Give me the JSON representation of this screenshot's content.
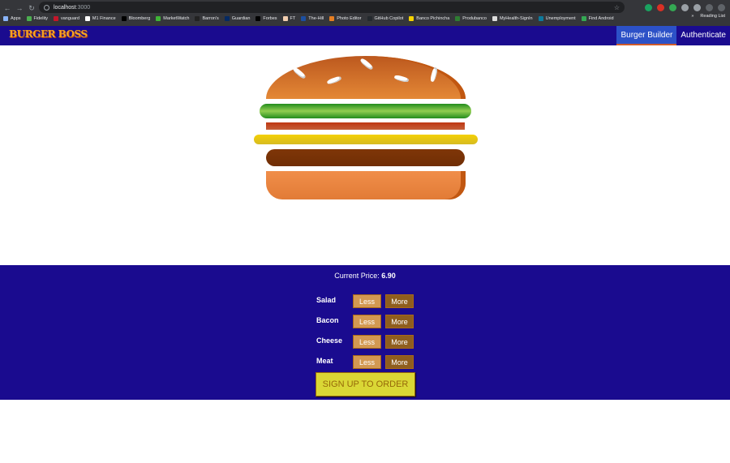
{
  "browser": {
    "url_host": "localhost",
    "url_port": ":3000",
    "bookmarks": [
      "Apps",
      "Fidelity",
      "vanguard",
      "M1 Finance",
      "Bloomberg",
      "MarketWatch",
      "Barron's",
      "Guardian",
      "Forbes",
      "FT",
      "The-Hill",
      "Photo Editor",
      "GitHub Copilot",
      "Banco Pichincha",
      "Produbanco",
      "MyHealth-SignIn",
      "Unemployment",
      "Find Android"
    ],
    "reading_list": "Reading List",
    "more_bookmarks": "»"
  },
  "toolbar": {
    "logo_text": "BURGER BOSS",
    "nav": [
      {
        "label": "Burger Builder",
        "active": true
      },
      {
        "label": "Authenticate",
        "active": false
      }
    ]
  },
  "burger": {
    "ingredients": [
      "salad",
      "bacon",
      "cheese",
      "meat"
    ]
  },
  "controls": {
    "price_label": "Current Price:",
    "price_value": "6.90",
    "rows": [
      {
        "label": "Salad",
        "less": "Less",
        "more": "More"
      },
      {
        "label": "Bacon",
        "less": "Less",
        "more": "More"
      },
      {
        "label": "Cheese",
        "less": "Less",
        "more": "More"
      },
      {
        "label": "Meat",
        "less": "Less",
        "more": "More"
      }
    ],
    "order_label": "SIGN UP TO ORDER"
  },
  "colors": {
    "toolbar_bg": "#1a0b8f",
    "nav_active": "#2c51c7",
    "order_btn": "#dad735"
  }
}
